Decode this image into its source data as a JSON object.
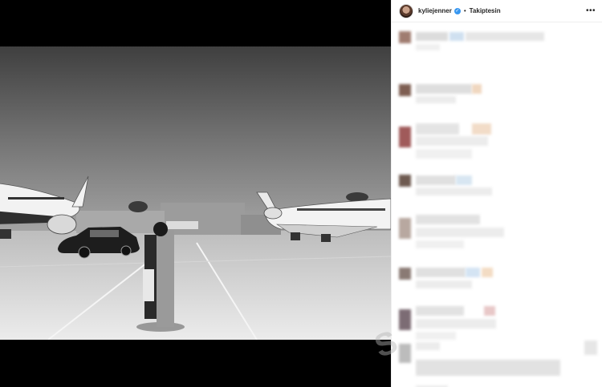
{
  "post": {
    "username": "kyliejenner",
    "verified_mark": "✓",
    "separator": "•",
    "follow_label": "Takiptesin",
    "more_label": "•••"
  },
  "colors": {
    "verified": "#3897f0",
    "panel_bg": "#ffffff",
    "letterbox": "#000000"
  },
  "icons": {
    "more": "more-options-icon",
    "verified": "verified-badge-icon"
  },
  "watermark_text": "S"
}
